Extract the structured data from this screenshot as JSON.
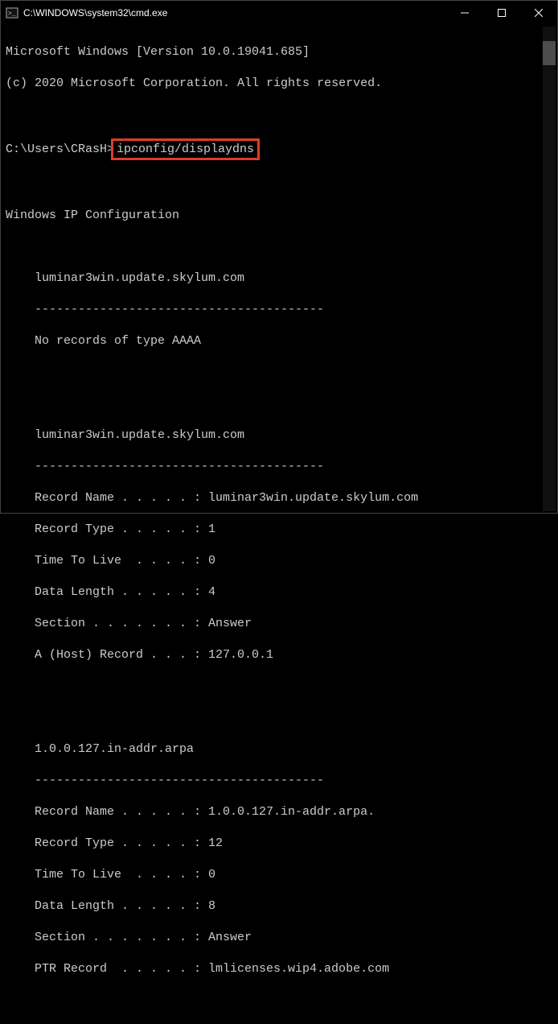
{
  "titlebar": {
    "title": "C:\\WINDOWS\\system32\\cmd.exe"
  },
  "header": {
    "line1": "Microsoft Windows [Version 10.0.19041.685]",
    "line2": "(c) 2020 Microsoft Corporation. All rights reserved."
  },
  "prompt": {
    "path": "C:\\Users\\CRasH>",
    "command": "ipconfig/displaydns"
  },
  "config_header": "Windows IP Configuration",
  "block1": {
    "host": "luminar3win.update.skylum.com",
    "sep": "----------------------------------------",
    "msg": "No records of type AAAA"
  },
  "block2": {
    "host": "luminar3win.update.skylum.com",
    "sep": "----------------------------------------",
    "fields": [
      "Record Name . . . . . : luminar3win.update.skylum.com",
      "Record Type . . . . . : 1",
      "Time To Live  . . . . : 0",
      "Data Length . . . . . : 4",
      "Section . . . . . . . : Answer",
      "A (Host) Record . . . : 127.0.0.1"
    ]
  },
  "block3": {
    "host": "1.0.0.127.in-addr.arpa",
    "sep": "----------------------------------------",
    "fields": [
      "Record Name . . . . . : 1.0.0.127.in-addr.arpa.",
      "Record Type . . . . . : 12",
      "Time To Live  . . . . : 0",
      "Data Length . . . . . : 8",
      "Section . . . . . . . : Answer",
      "PTR Record  . . . . . : lmlicenses.wip4.adobe.com"
    ]
  }
}
